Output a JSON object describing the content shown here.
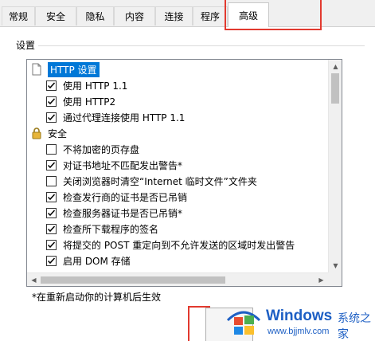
{
  "tabs": [
    {
      "label": "常规"
    },
    {
      "label": "安全"
    },
    {
      "label": "隐私"
    },
    {
      "label": "内容"
    },
    {
      "label": "连接"
    },
    {
      "label": "程序"
    },
    {
      "label": "高级",
      "active": true
    }
  ],
  "group": {
    "title": "设置"
  },
  "tree": {
    "http_header": "HTTP 设置",
    "http_items": [
      {
        "label": "使用 HTTP 1.1",
        "checked": true
      },
      {
        "label": "使用 HTTP2",
        "checked": true
      },
      {
        "label": "通过代理连接使用 HTTP 1.1",
        "checked": true
      }
    ],
    "security_header": "安全",
    "security_items": [
      {
        "label": "不将加密的页存盘",
        "checked": false
      },
      {
        "label": "对证书地址不匹配发出警告*",
        "checked": true
      },
      {
        "label": "关闭浏览器时清空“Internet 临时文件”文件夹",
        "checked": false
      },
      {
        "label": "检查发行商的证书是否已吊销",
        "checked": true
      },
      {
        "label": "检查服务器证书是否已吊销*",
        "checked": true
      },
      {
        "label": "检查所下载程序的签名",
        "checked": true
      },
      {
        "label": "将提交的 POST 重定向到不允许发送的区域时发出警告",
        "checked": true
      },
      {
        "label": "启用 DOM 存储",
        "checked": true
      }
    ]
  },
  "footnote": "*在重新启动你的计算机后生效",
  "watermark": {
    "title": "Windows",
    "subtitle": "系统之家",
    "url": "www.bjjmlv.com"
  },
  "colors": {
    "highlight_box": "#e23a2f",
    "selection": "#0078d7",
    "watermark": "#1d5fc4"
  }
}
